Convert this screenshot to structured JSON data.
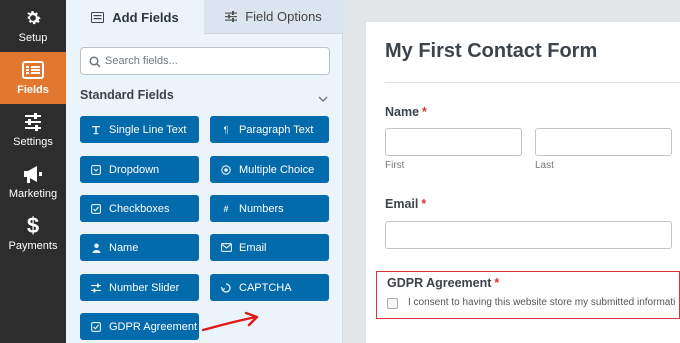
{
  "sidebar": {
    "items": [
      {
        "label": "Setup",
        "icon": "gear-icon"
      },
      {
        "label": "Fields",
        "icon": "fields-list-icon",
        "active": true
      },
      {
        "label": "Settings",
        "icon": "sliders-icon"
      },
      {
        "label": "Marketing",
        "icon": "megaphone-icon"
      },
      {
        "label": "Payments",
        "icon": "dollar-icon"
      }
    ]
  },
  "panel": {
    "tabs": [
      {
        "label": "Add Fields",
        "icon": "list-icon",
        "active": true
      },
      {
        "label": "Field Options",
        "icon": "sliders-icon",
        "active": false
      }
    ],
    "search": {
      "placeholder": "Search fields..."
    },
    "section_title": "Standard Fields",
    "fields": [
      {
        "label": "Single Line Text",
        "icon": "text-cursor-icon"
      },
      {
        "label": "Paragraph Text",
        "icon": "paragraph-icon"
      },
      {
        "label": "Dropdown",
        "icon": "dropdown-icon"
      },
      {
        "label": "Multiple Choice",
        "icon": "radio-icon"
      },
      {
        "label": "Checkboxes",
        "icon": "checkbox-icon"
      },
      {
        "label": "Numbers",
        "icon": "hash-icon"
      },
      {
        "label": "Name",
        "icon": "user-icon"
      },
      {
        "label": "Email",
        "icon": "envelope-icon"
      },
      {
        "label": "Number Slider",
        "icon": "sliders-icon"
      },
      {
        "label": "CAPTCHA",
        "icon": "captcha-icon"
      },
      {
        "label": "GDPR Agreement",
        "icon": "checkbox-icon"
      }
    ]
  },
  "preview": {
    "form_title": "My First Contact Form",
    "name_label": "Name",
    "required_mark": "*",
    "first_sublabel": "First",
    "last_sublabel": "Last",
    "email_label": "Email",
    "gdpr_label": "GDPR Agreement",
    "gdpr_text": "I consent to having this website store my submitted informati"
  },
  "colors": {
    "accent": "#e27730",
    "field_button": "#036aab",
    "nav_bg": "#2d2d2d",
    "panel_bg": "#ebf3fb",
    "required": "#d63638",
    "annotation_arrow": "#e0191a"
  }
}
